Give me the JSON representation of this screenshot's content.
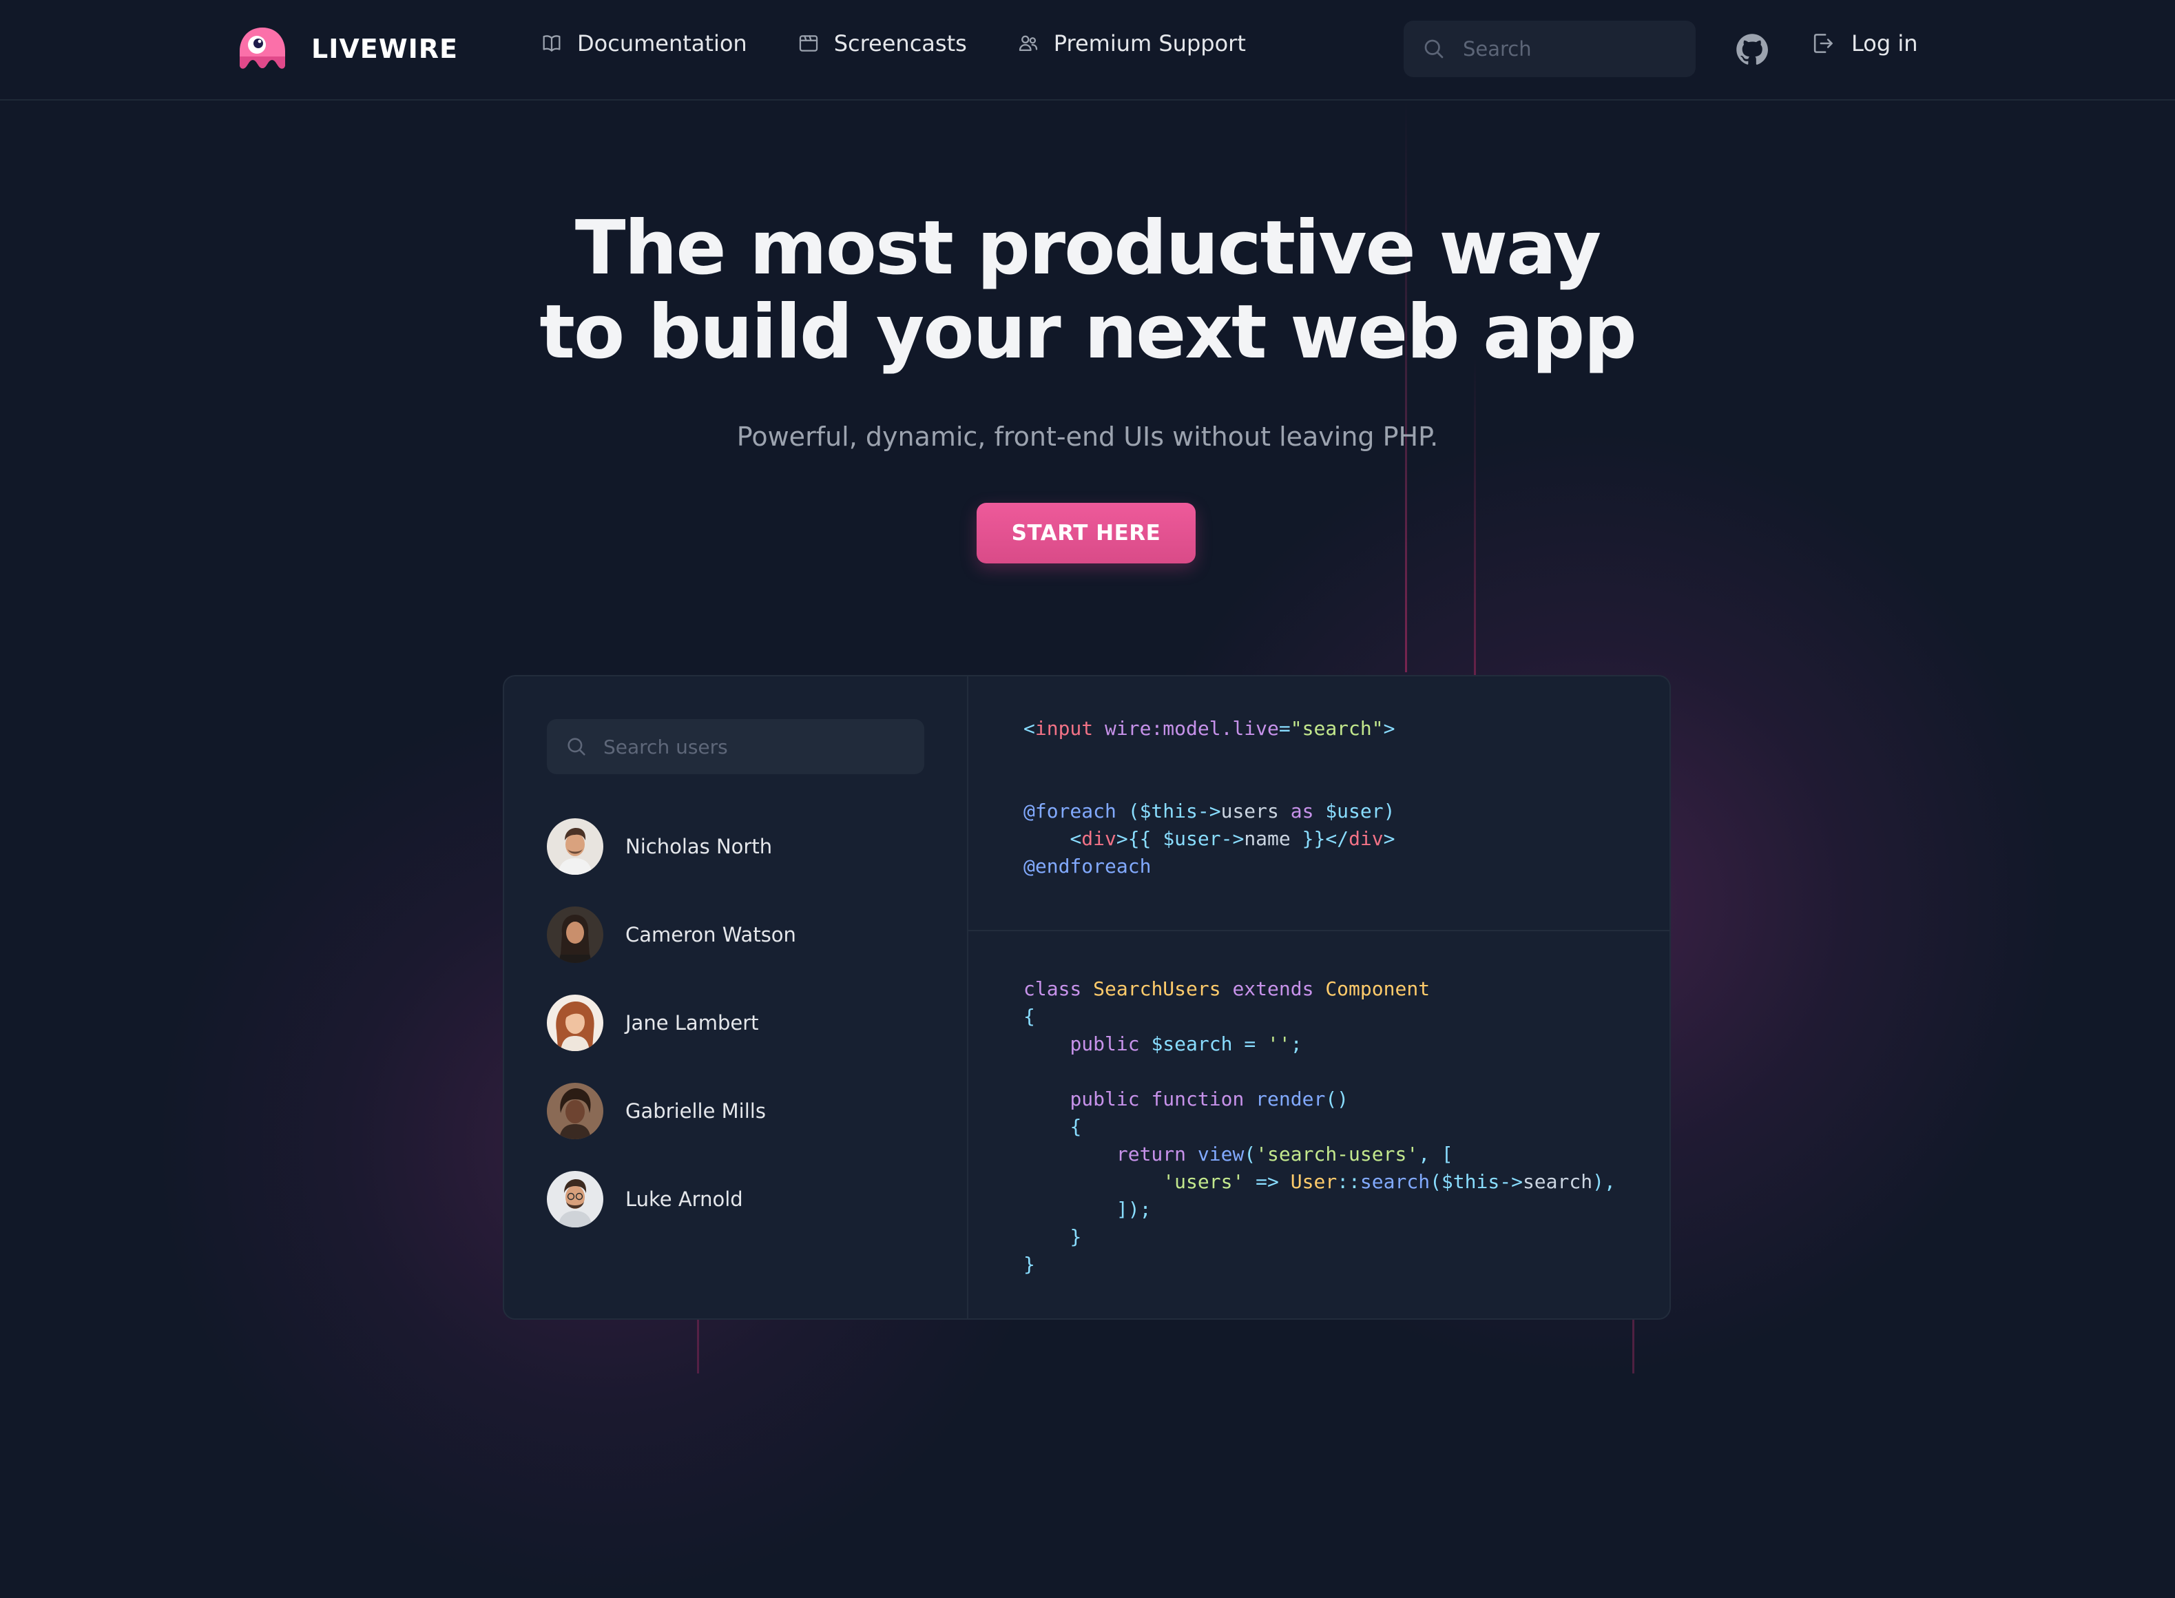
{
  "header": {
    "brand": "LIVEWIRE",
    "nav": [
      {
        "label": "Documentation",
        "icon": "book-icon"
      },
      {
        "label": "Screencasts",
        "icon": "video-icon"
      },
      {
        "label": "Premium Support",
        "icon": "users-icon"
      }
    ],
    "search_placeholder": "Search",
    "login_label": "Log in"
  },
  "hero": {
    "title_line1": "The most productive way",
    "title_line2": "to build your next web app",
    "subtitle": "Powerful, dynamic, front-end UIs without leaving PHP.",
    "cta_label": "START HERE"
  },
  "demo": {
    "search_placeholder": "Search users",
    "users": [
      {
        "name": "Nicholas North"
      },
      {
        "name": "Cameron Watson"
      },
      {
        "name": "Jane Lambert"
      },
      {
        "name": "Gabrielle Mills"
      },
      {
        "name": "Luke Arnold"
      }
    ]
  },
  "colors": {
    "background": "#111828",
    "accent_pink": "#ec4899",
    "panel": "#172031"
  }
}
